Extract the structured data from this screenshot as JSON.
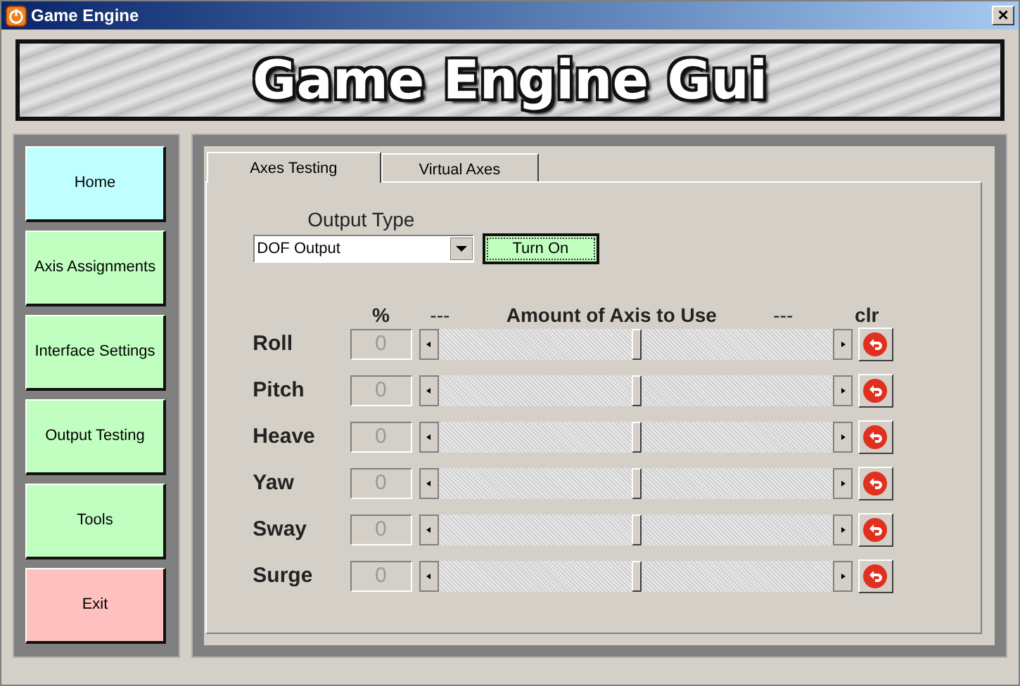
{
  "window": {
    "title": "Game Engine",
    "close": "×"
  },
  "banner": {
    "title": "Game Engine Gui"
  },
  "sidebar": {
    "items": [
      {
        "label": "Home",
        "color": "#c0ffff"
      },
      {
        "label": "Axis Assignments",
        "color": "#c0ffc0"
      },
      {
        "label": "Interface Settings",
        "color": "#c0ffc0"
      },
      {
        "label": "Output Testing",
        "color": "#c0ffc0"
      },
      {
        "label": "Tools",
        "color": "#c0ffc0"
      },
      {
        "label": "Exit",
        "color": "#ffc0c0"
      }
    ]
  },
  "tabs": [
    {
      "label": "Axes Testing",
      "selected": true
    },
    {
      "label": "Virtual Axes",
      "selected": false
    }
  ],
  "output_type": {
    "label": "Output Type",
    "value": "DOF Output",
    "button": "Turn On"
  },
  "axes": {
    "columns": [
      "%",
      "---",
      "Amount of Axis to Use",
      "---",
      "clr"
    ],
    "rows": [
      {
        "name": "Roll",
        "value": "0",
        "level": 0.5
      },
      {
        "name": "Pitch",
        "value": "0",
        "level": 0.5
      },
      {
        "name": "Heave",
        "value": "0",
        "level": 0.5
      },
      {
        "name": "Yaw",
        "value": "0",
        "level": 0.5
      },
      {
        "name": "Sway",
        "value": "0",
        "level": 0.5
      },
      {
        "name": "Surge",
        "value": "0",
        "level": 0.5
      }
    ]
  }
}
